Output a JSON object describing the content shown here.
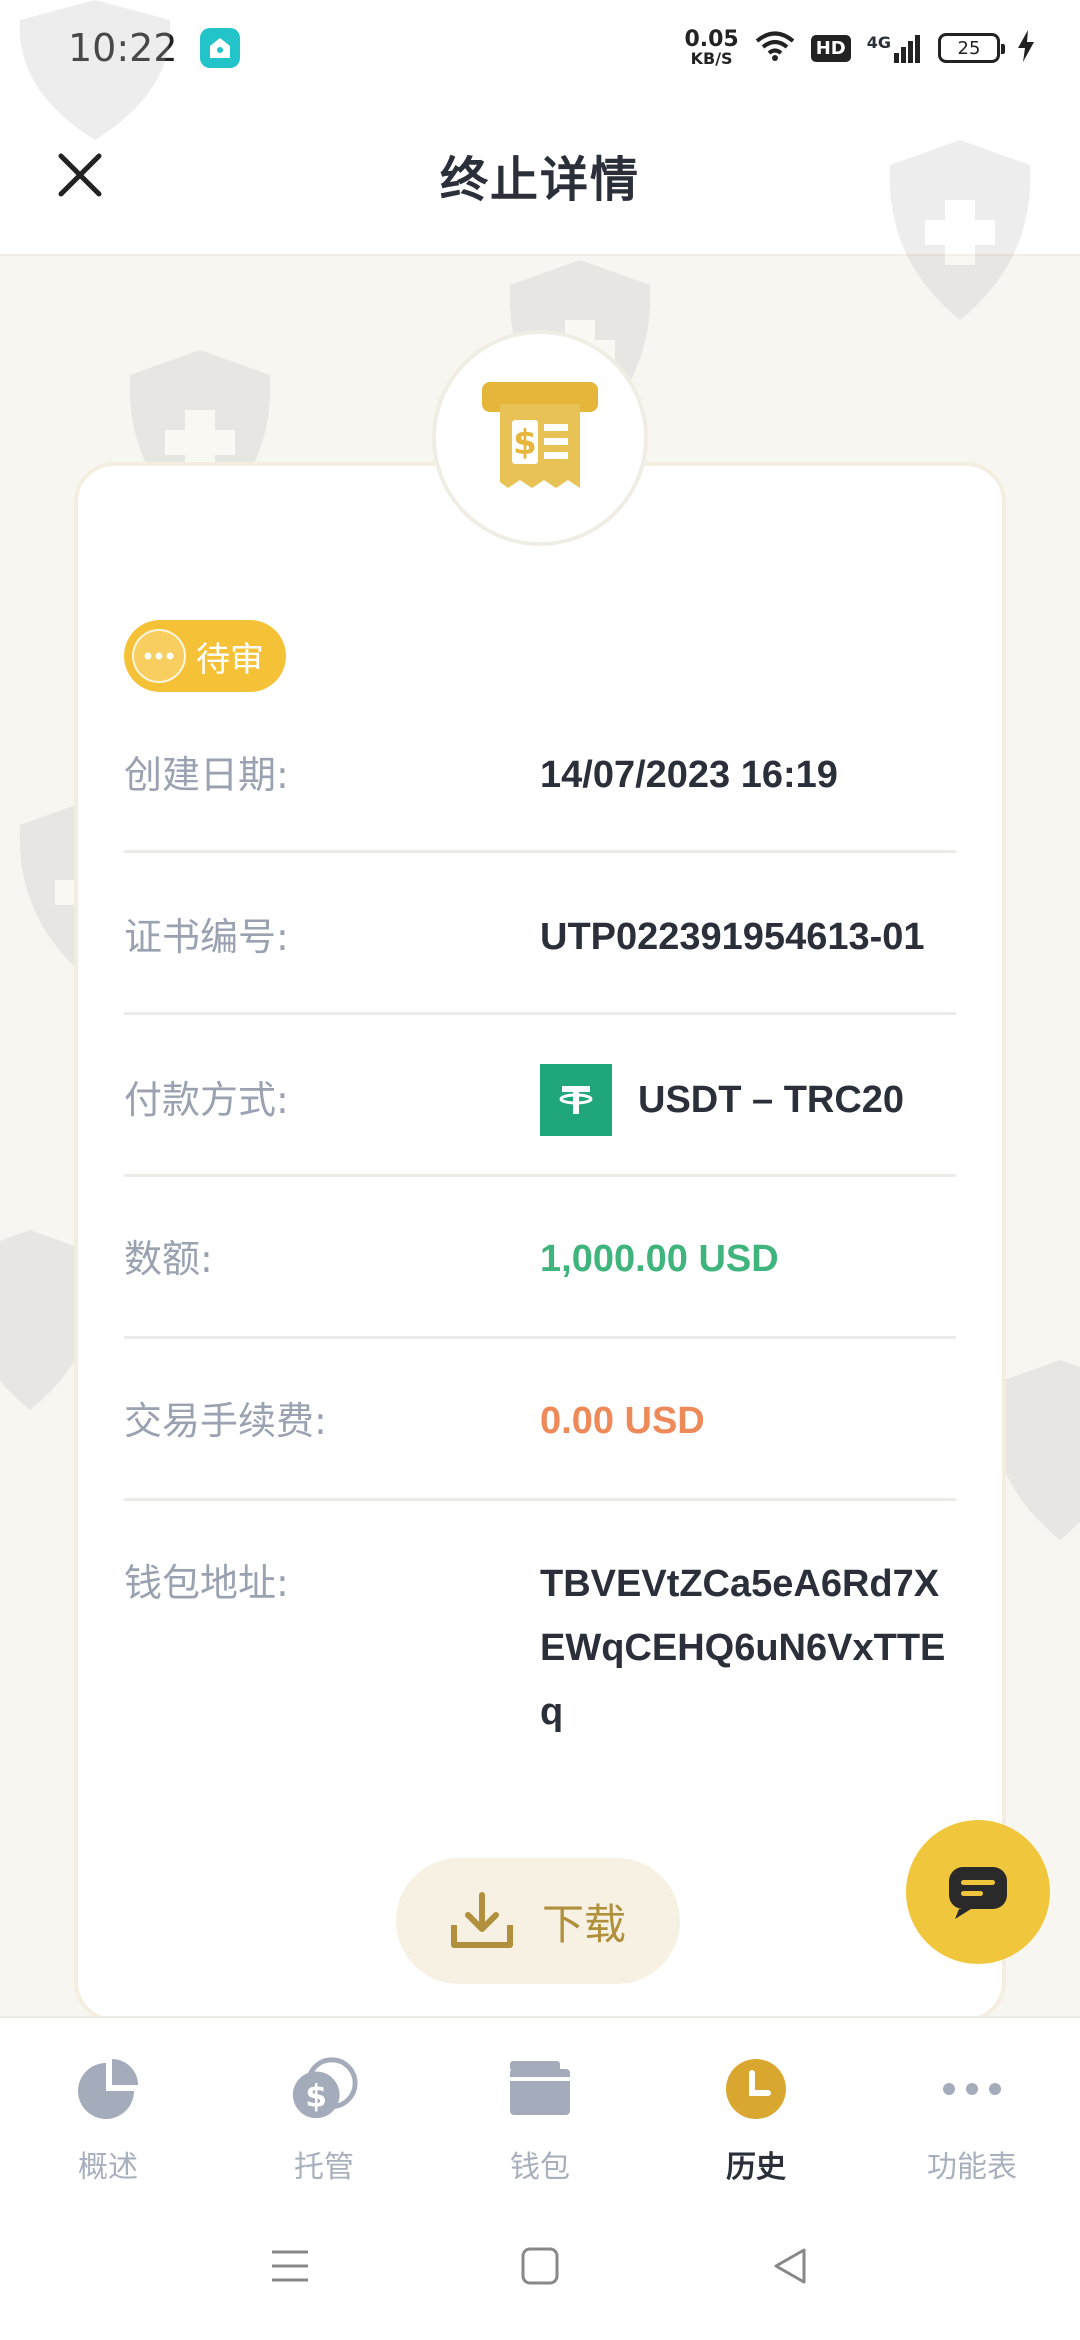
{
  "status_bar": {
    "time": "10:22",
    "net_speed_value": "0.05",
    "net_speed_unit": "KB/S",
    "hd": "HD",
    "network": "4G",
    "battery": "25"
  },
  "header": {
    "title": "终止详情"
  },
  "detail": {
    "status": "待审",
    "rows": [
      {
        "label": "创建日期:",
        "value": "14/07/2023 16:19"
      },
      {
        "label": "证书编号:",
        "value": "UTP022391954613-01"
      },
      {
        "label": "付款方式:",
        "value": "USDT – TRC20"
      },
      {
        "label": "数额:",
        "value": "1,000.00 USD"
      },
      {
        "label": "交易手续费:",
        "value": "0.00 USD"
      },
      {
        "label": "钱包地址:",
        "value": "TBVEVtZCa5eA6Rd7XEWqCEHQ6uN6VxTTEq"
      }
    ],
    "download_label": "下载"
  },
  "bottom_nav": {
    "items": [
      {
        "label": "概述",
        "icon": "pie-chart-icon"
      },
      {
        "label": "托管",
        "icon": "coins-icon"
      },
      {
        "label": "钱包",
        "icon": "wallet-icon"
      },
      {
        "label": "历史",
        "icon": "clock-icon",
        "active": true
      },
      {
        "label": "功能表",
        "icon": "more-icon"
      }
    ]
  },
  "colors": {
    "accent_gold": "#f5c237",
    "amount_green": "#3fb47d",
    "fee_orange": "#ee8a5a",
    "usdt_green": "#1fa67a"
  }
}
